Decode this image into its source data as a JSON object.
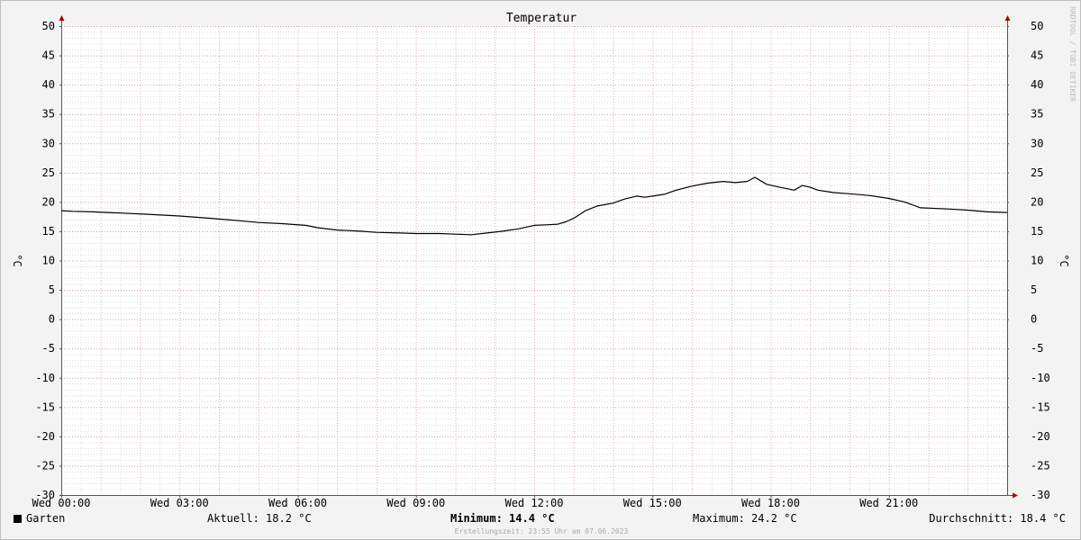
{
  "watermark": "RRDTOOL / TOBI OETIKER",
  "footer": "Erstellungszeit: 23:55 Uhr am 07.06.2023",
  "legend": {
    "series_name": "Garten",
    "current": "Aktuell: 18.2 °C",
    "minimum": "Minimum: 14.4 °C",
    "maximum": "Maximum: 24.2 °C",
    "average": "Durchschnitt: 18.4 °C"
  },
  "chart_data": {
    "type": "line",
    "title": "Temperatur",
    "ylabel_left": "°C",
    "ylabel_right": "°C",
    "xlim": [
      0,
      24
    ],
    "ylim": [
      -30,
      50
    ],
    "y_major_step": 5,
    "y_minor_step": 1,
    "grid": true,
    "x_ticks": [
      {
        "pos": 0,
        "label": "Wed 00:00"
      },
      {
        "pos": 3,
        "label": "Wed 03:00"
      },
      {
        "pos": 6,
        "label": "Wed 06:00"
      },
      {
        "pos": 9,
        "label": "Wed 09:00"
      },
      {
        "pos": 12,
        "label": "Wed 12:00"
      },
      {
        "pos": 15,
        "label": "Wed 15:00"
      },
      {
        "pos": 18,
        "label": "Wed 18:00"
      },
      {
        "pos": 21,
        "label": "Wed 21:00"
      }
    ],
    "series": [
      {
        "name": "Garten",
        "color": "#000000",
        "x": [
          0,
          0.3,
          0.8,
          1.5,
          2.2,
          3.0,
          3.8,
          4.5,
          5.0,
          5.6,
          6.2,
          6.5,
          7.0,
          7.6,
          8.0,
          8.6,
          9.0,
          9.6,
          10.0,
          10.4,
          10.8,
          11.2,
          11.6,
          12.0,
          12.3,
          12.6,
          12.8,
          13.0,
          13.3,
          13.6,
          14.0,
          14.3,
          14.6,
          14.8,
          15.0,
          15.3,
          15.6,
          16.0,
          16.4,
          16.8,
          17.1,
          17.4,
          17.6,
          17.9,
          18.3,
          18.6,
          18.8,
          19.0,
          19.2,
          19.6,
          20.0,
          20.5,
          21.0,
          21.4,
          21.8,
          22.5,
          23.0,
          23.5,
          24.0
        ],
        "y": [
          18.5,
          18.4,
          18.3,
          18.1,
          17.9,
          17.6,
          17.2,
          16.8,
          16.5,
          16.3,
          16.0,
          15.6,
          15.2,
          15.0,
          14.8,
          14.7,
          14.6,
          14.6,
          14.5,
          14.4,
          14.7,
          15.0,
          15.4,
          16.0,
          16.1,
          16.2,
          16.6,
          17.2,
          18.5,
          19.3,
          19.8,
          20.5,
          21.0,
          20.8,
          21.0,
          21.3,
          22.0,
          22.7,
          23.2,
          23.5,
          23.3,
          23.5,
          24.2,
          23.0,
          22.4,
          22.0,
          22.8,
          22.5,
          22.0,
          21.6,
          21.4,
          21.1,
          20.6,
          20.0,
          19.0,
          18.8,
          18.6,
          18.3,
          18.2
        ]
      }
    ]
  }
}
